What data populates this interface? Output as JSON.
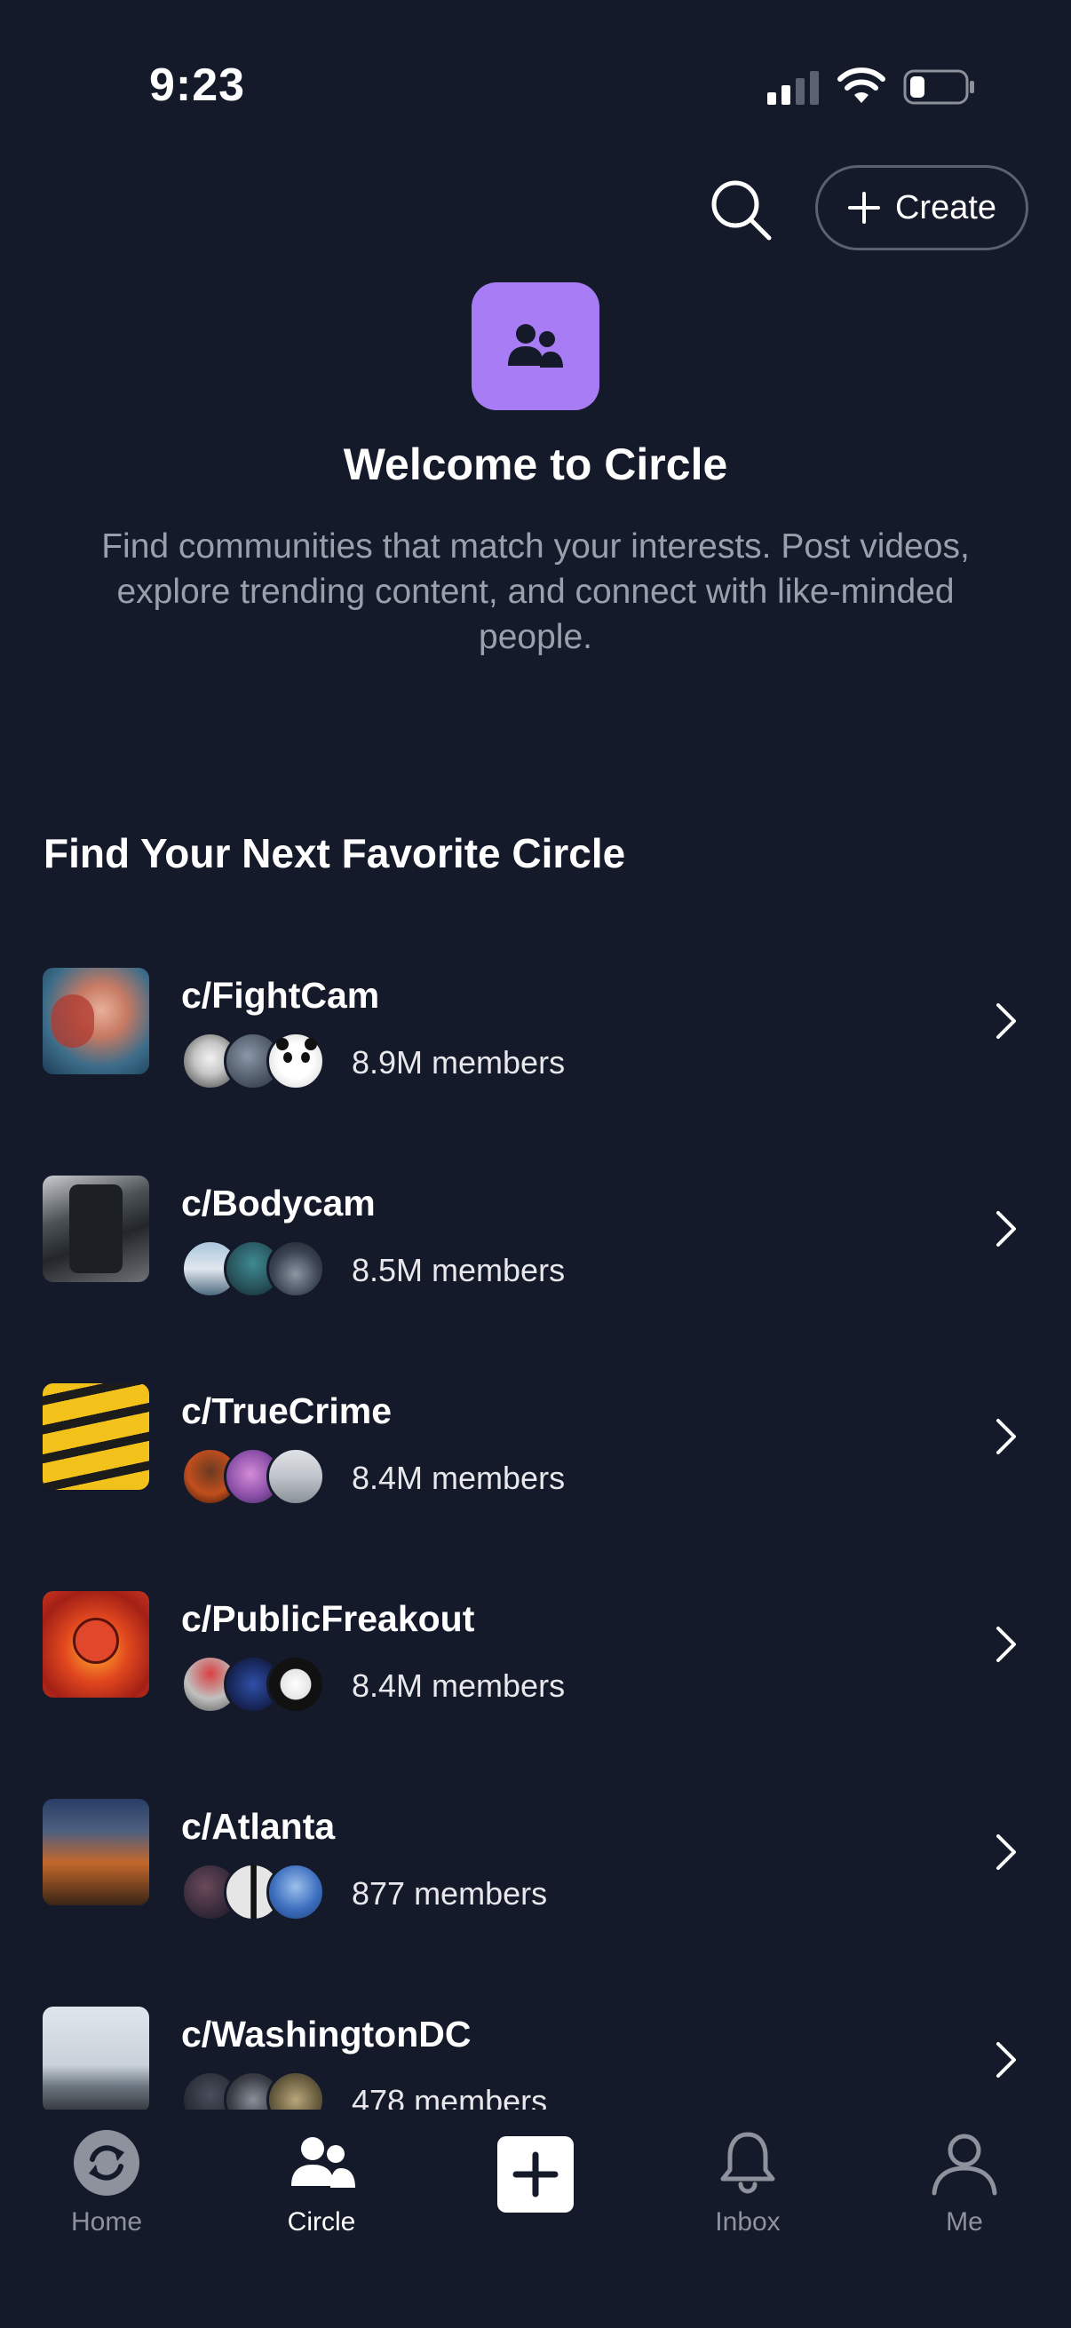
{
  "status_bar": {
    "time": "9:23"
  },
  "header": {
    "create_label": "Create"
  },
  "hero": {
    "title": "Welcome to Circle",
    "description": "Find communities that match your interests. Post videos, explore trending content, and connect with like-minded people."
  },
  "section": {
    "title": "Find Your Next Favorite Circle"
  },
  "communities": [
    {
      "name": "c/FightCam",
      "members": "8.9M members"
    },
    {
      "name": "c/Bodycam",
      "members": "8.5M members"
    },
    {
      "name": "c/TrueCrime",
      "members": "8.4M members"
    },
    {
      "name": "c/PublicFreakout",
      "members": "8.4M members"
    },
    {
      "name": "c/Atlanta",
      "members": "877 members"
    },
    {
      "name": "c/WashingtonDC",
      "members": "478 members"
    }
  ],
  "tabbar": {
    "home": "Home",
    "circle": "Circle",
    "inbox": "Inbox",
    "me": "Me"
  },
  "colors": {
    "background": "#151a2a",
    "accent": "#a77cf4",
    "muted_text": "#9aa0ab"
  }
}
